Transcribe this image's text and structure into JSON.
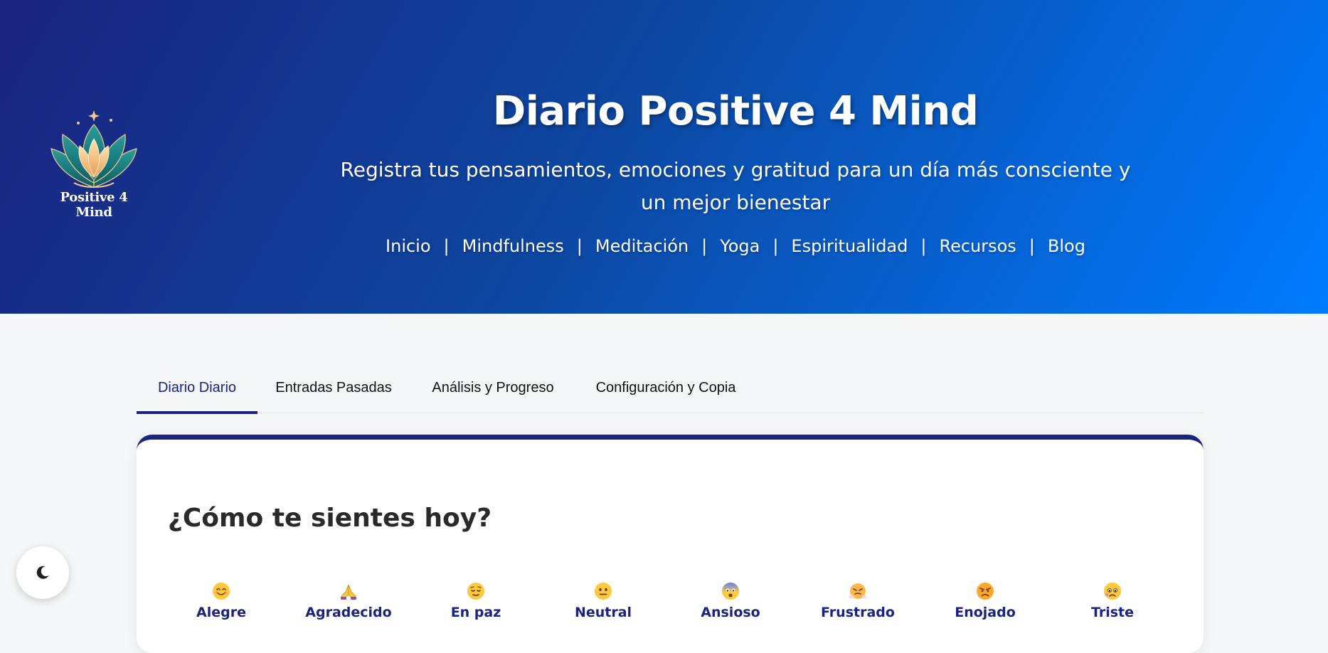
{
  "hero": {
    "logo_text": "Positive 4 Mind",
    "title": "Diario Positive 4 Mind",
    "subtitle": "Registra tus pensamientos, emociones y gratitud para un día más consciente y un mejor bienestar"
  },
  "nav": {
    "items": [
      {
        "label": "Inicio"
      },
      {
        "label": "Mindfulness"
      },
      {
        "label": "Meditación"
      },
      {
        "label": "Yoga"
      },
      {
        "label": "Espiritualidad"
      },
      {
        "label": "Recursos"
      },
      {
        "label": "Blog"
      }
    ],
    "separator": "|"
  },
  "tabs": [
    {
      "label": "Diario Diario",
      "active": true
    },
    {
      "label": "Entradas Pasadas",
      "active": false
    },
    {
      "label": "Análisis y Progreso",
      "active": false
    },
    {
      "label": "Configuración y Copia",
      "active": false
    }
  ],
  "mood_card": {
    "title": "¿Cómo te sientes hoy?",
    "moods": [
      {
        "label": "Alegre",
        "icon": "smiling-face-icon"
      },
      {
        "label": "Agradecido",
        "icon": "folded-hands-icon"
      },
      {
        "label": "En paz",
        "icon": "relieved-face-icon"
      },
      {
        "label": "Neutral",
        "icon": "neutral-face-icon"
      },
      {
        "label": "Ansioso",
        "icon": "fearful-face-icon"
      },
      {
        "label": "Frustrado",
        "icon": "steaming-face-icon"
      },
      {
        "label": "Enojado",
        "icon": "angry-face-icon"
      },
      {
        "label": "Triste",
        "icon": "sad-face-icon"
      }
    ]
  },
  "theme_toggle": {
    "icon": "moon-icon"
  },
  "colors": {
    "primary": "#1a237e",
    "accent": "#007bff",
    "hero_mid": "#0d47a1",
    "page_bg": "#f6f7f9"
  }
}
